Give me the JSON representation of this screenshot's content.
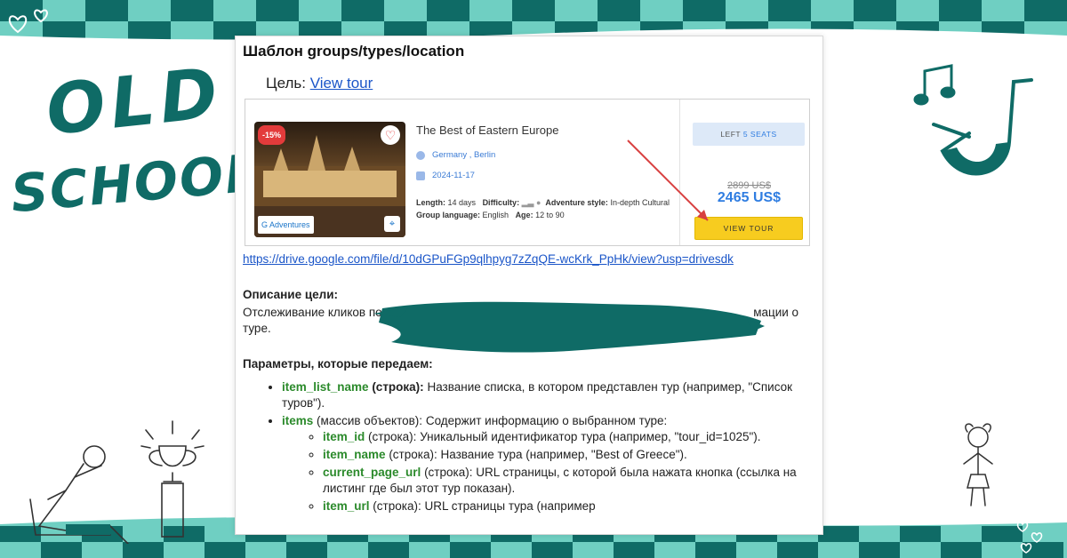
{
  "banner": {
    "logo_line1": "OLD",
    "logo_line2": "SCHOOL",
    "colors": {
      "teal": "#0f6b66",
      "light_teal": "#6fcfc2",
      "white": "#ffffff"
    }
  },
  "doc": {
    "title": "Шаблон groups/types/location",
    "goal_label": "Цель:",
    "goal_link": "View tour",
    "drive_link": "https://drive.google.com/file/d/10dGPuFGp9qlhpyg7zZqQE-wcKrk_PpHk/view?usp=drivesdk",
    "description_title": "Описание цели:",
    "description_text_start": "Отслеживание кликов по",
    "description_text_end": "мации о",
    "description_text_line2": "туре.",
    "params_title": "Параметры, которые передаем:",
    "params": [
      {
        "key": "item_list_name",
        "type": "(строка):",
        "desc": " Название списка, в котором представлен тур (например, \"Список туров\")."
      },
      {
        "key": "items",
        "type": "(массив объектов):",
        "desc": " Содержит информацию о выбранном туре:"
      }
    ],
    "sub_params": [
      {
        "key": "item_id",
        "type": "(строка):",
        "desc": " Уникальный идентификатор тура (например, \"tour_id=1025\")."
      },
      {
        "key": "item_name",
        "type": "(строка):",
        "desc": " Название тура (например, \"Best of Greece\")."
      },
      {
        "key": "current_page_url",
        "type": "(строка):",
        "desc": " URL страницы, с которой была нажата кнопка (ссылка на листинг где был этот тур показан)."
      },
      {
        "key": "item_url",
        "type": "(строка):",
        "desc": " URL страницы тура (например"
      }
    ]
  },
  "tour_card": {
    "sale_badge": "-15%",
    "operator": "G Adventures",
    "name": "The Best of Eastern Europe",
    "location": "Germany , Berlin",
    "date": "2024-11-17",
    "length_label": "Length:",
    "length_value": "14 days",
    "difficulty_label": "Difficulty:",
    "adventure_label": "Adventure style:",
    "adventure_value": "In-depth Cultural",
    "language_label": "Group language:",
    "language_value": "English",
    "age_label": "Age:",
    "age_value": "12 to 90",
    "seats_prefix": "LEFT",
    "seats_value": "5 SEATS",
    "old_price": "2899 US$",
    "new_price": "2465 US$",
    "button": "VIEW TOUR",
    "colors": {
      "price": "#2f7de1",
      "button": "#f7cc1f",
      "badge": "#e33b3b"
    }
  }
}
